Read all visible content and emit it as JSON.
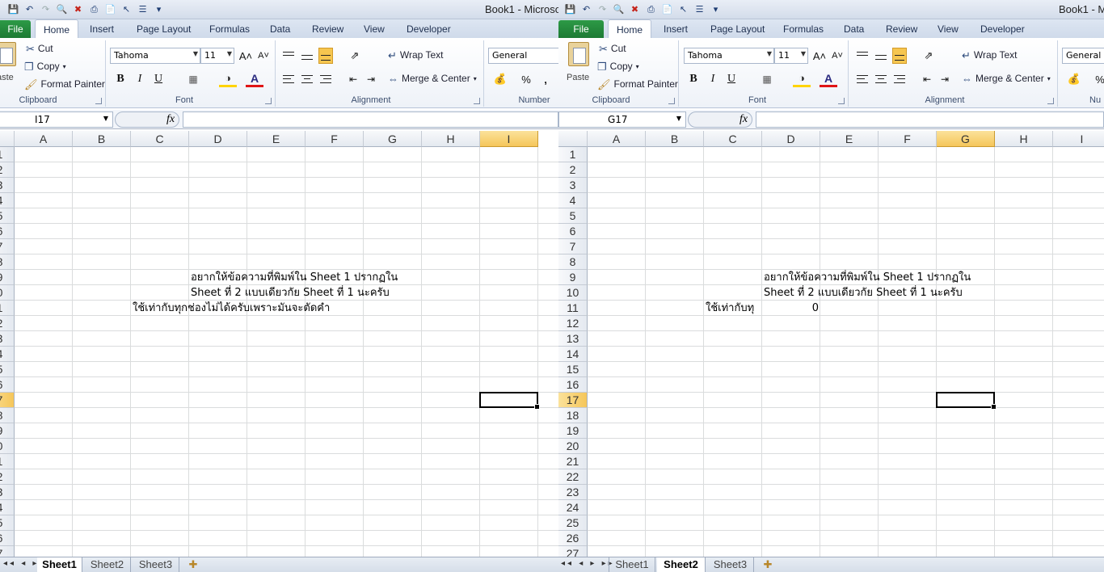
{
  "window": {
    "title_left": "Book1 - Microso",
    "title_right": "Book1 - M"
  },
  "ribbon": {
    "file_tab": "File",
    "tabs": [
      "Home",
      "Insert",
      "Page Layout",
      "Formulas",
      "Data",
      "Review",
      "View",
      "Developer"
    ],
    "active_tab": "Home",
    "clipboard": {
      "paste_label": "Paste",
      "paste_label_clipped": "aste",
      "cut": "Cut",
      "copy": "Copy",
      "format_painter": "Format Painter",
      "group_label": "Clipboard"
    },
    "font": {
      "font_name": "Tahoma",
      "font_size": "11",
      "bold": "B",
      "italic": "I",
      "underline": "U",
      "font_color_glyph": "A",
      "group_label": "Font"
    },
    "alignment": {
      "wrap_text": "Wrap Text",
      "merge_center": "Merge & Center",
      "group_label": "Alignment"
    },
    "number": {
      "format": "General",
      "percent": "%",
      "comma": ",",
      "group_label": "Number",
      "group_label_clipped": "Nu"
    }
  },
  "left_pane": {
    "name_box": "I17",
    "fx_label": "fx",
    "columns": [
      "A",
      "B",
      "C",
      "D",
      "E",
      "F",
      "G",
      "H",
      "I"
    ],
    "selected_column": "I",
    "row_labels": [
      "1",
      "2",
      "3",
      "4",
      "5",
      "6",
      "7",
      "8",
      "9",
      "0",
      "1",
      "2",
      "3",
      "4",
      "5",
      "6",
      "7",
      "8",
      "9",
      "0",
      "1",
      "2",
      "3",
      "4",
      "5",
      "6",
      "7"
    ],
    "selected_row": "7",
    "cells": {
      "D9": "อยากให้ข้อความที่พิมพ์ใน Sheet 1 ปรากฏใน",
      "D10": "Sheet ที่ 2 แบบเดียวกัย Sheet ที่ 1 นะครับ",
      "C11": "ใช้เท่ากับทุกช่องไม่ได้ครับเพราะมันจะตัดคำ"
    },
    "sheet_tabs": [
      "Sheet1",
      "Sheet2",
      "Sheet3"
    ],
    "active_sheet": "Sheet1"
  },
  "right_pane": {
    "name_box": "G17",
    "fx_label": "fx",
    "columns": [
      "A",
      "B",
      "C",
      "D",
      "E",
      "F",
      "G",
      "H",
      "I"
    ],
    "selected_column": "G",
    "row_labels": [
      "1",
      "2",
      "3",
      "4",
      "5",
      "6",
      "7",
      "8",
      "9",
      "10",
      "11",
      "12",
      "13",
      "14",
      "15",
      "16",
      "17",
      "18",
      "19",
      "20",
      "21",
      "22",
      "23",
      "24",
      "25",
      "26",
      "27"
    ],
    "selected_row": "17",
    "cells": {
      "D9": "อยากให้ข้อความที่พิมพ์ใน Sheet 1 ปรากฏใน",
      "D10": "Sheet ที่ 2 แบบเดียวกัย Sheet ที่ 1 นะครับ",
      "C11": "ใช้เท่ากับทุ",
      "D11": "0"
    },
    "sheet_tabs": [
      "Sheet1",
      "Sheet2",
      "Sheet3"
    ],
    "active_sheet": "Sheet2"
  },
  "icons": {
    "nav_glyphs": "◂◂ ◂ ▸ ▸▸",
    "insert_sheet": "new-sheet-icon"
  }
}
